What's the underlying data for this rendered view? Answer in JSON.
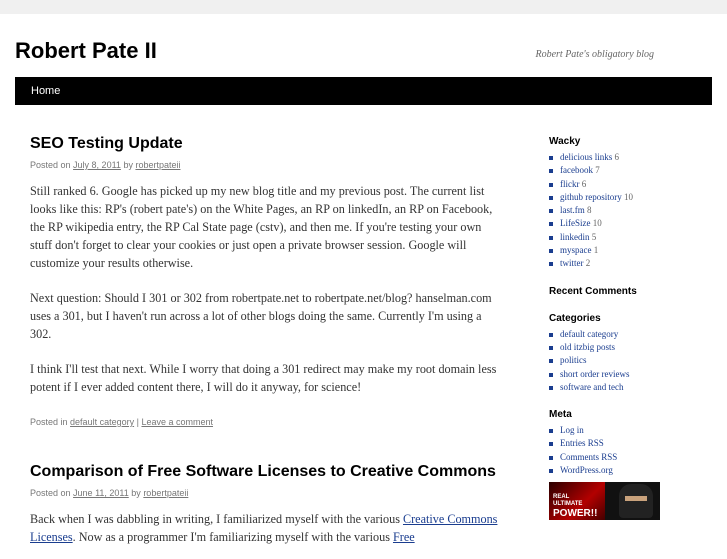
{
  "site": {
    "title": "Robert Pate II",
    "description": "Robert Pate's obligatory blog"
  },
  "nav": {
    "home": "Home"
  },
  "post1": {
    "title": "SEO Testing Update",
    "posted_on": "Posted on",
    "date": "July 8, 2011",
    "by": "by",
    "author": "robertpateii",
    "paragraphs": [
      "Still ranked 6. Google has picked up my new blog title and my previous post. The current list looks like this: RP's (robert pate's) on the White Pages, an RP on linkedIn, an RP on Facebook, the RP wikipedia entry, the RP Cal State page (cstv), and then me. If you're testing your own stuff don't forget to clear your cookies or just open a private browser session. Google will customize your results otherwise.",
      "Next question: Should I 301 or 302 from robertpate.net to robertpate.net/blog? hanselman.com uses a 301, but I haven't run across a lot of other blogs doing the same. Currently I'm using a 302.",
      "I think I'll test that next. While I worry that doing a 301 redirect may make my root domain less potent if I ever added content there, I will do it anyway, for science!"
    ],
    "posted_in": "Posted in",
    "category": "default category",
    "separator": "|",
    "comment_link": "Leave a comment"
  },
  "post2": {
    "title": "Comparison of Free Software Licenses to Creative Commons",
    "posted_on": "Posted on",
    "date": "June 11, 2011",
    "by": "by",
    "author": "robertpateii",
    "text_a": "Back when I was dabbling in writing, I familiarized myself with the various ",
    "link_a": "Creative Commons Licenses",
    "text_b": ". Now as a programmer I'm familiarizing myself with the various ",
    "link_b": "Free"
  },
  "sidebar": {
    "wacky": {
      "title": "Wacky",
      "items": [
        {
          "label": "delicious links",
          "count": "6"
        },
        {
          "label": "facebook",
          "count": "7"
        },
        {
          "label": "flickr",
          "count": "6"
        },
        {
          "label": "github repository",
          "count": "10"
        },
        {
          "label": "last.fm",
          "count": "8"
        },
        {
          "label": "LifeSize",
          "count": "10"
        },
        {
          "label": "linkedin",
          "count": "5"
        },
        {
          "label": "myspace",
          "count": "1"
        },
        {
          "label": "twitter",
          "count": "2"
        }
      ]
    },
    "recent_comments": {
      "title": "Recent Comments"
    },
    "categories": {
      "title": "Categories",
      "items": [
        "default category",
        "old itzbig posts",
        "politics",
        "short order reviews",
        "software and tech"
      ]
    },
    "meta": {
      "title": "Meta",
      "items": [
        "Log in",
        "Entries RSS",
        "Comments RSS",
        "WordPress.org"
      ]
    },
    "banner": {
      "line1": "REAL",
      "line2": "ULTIMATE",
      "line3": "POWER!!"
    }
  },
  "colors": {
    "link": "#1a3d8f",
    "nav_bg": "#000000",
    "top_band": "#f0f0f0"
  }
}
